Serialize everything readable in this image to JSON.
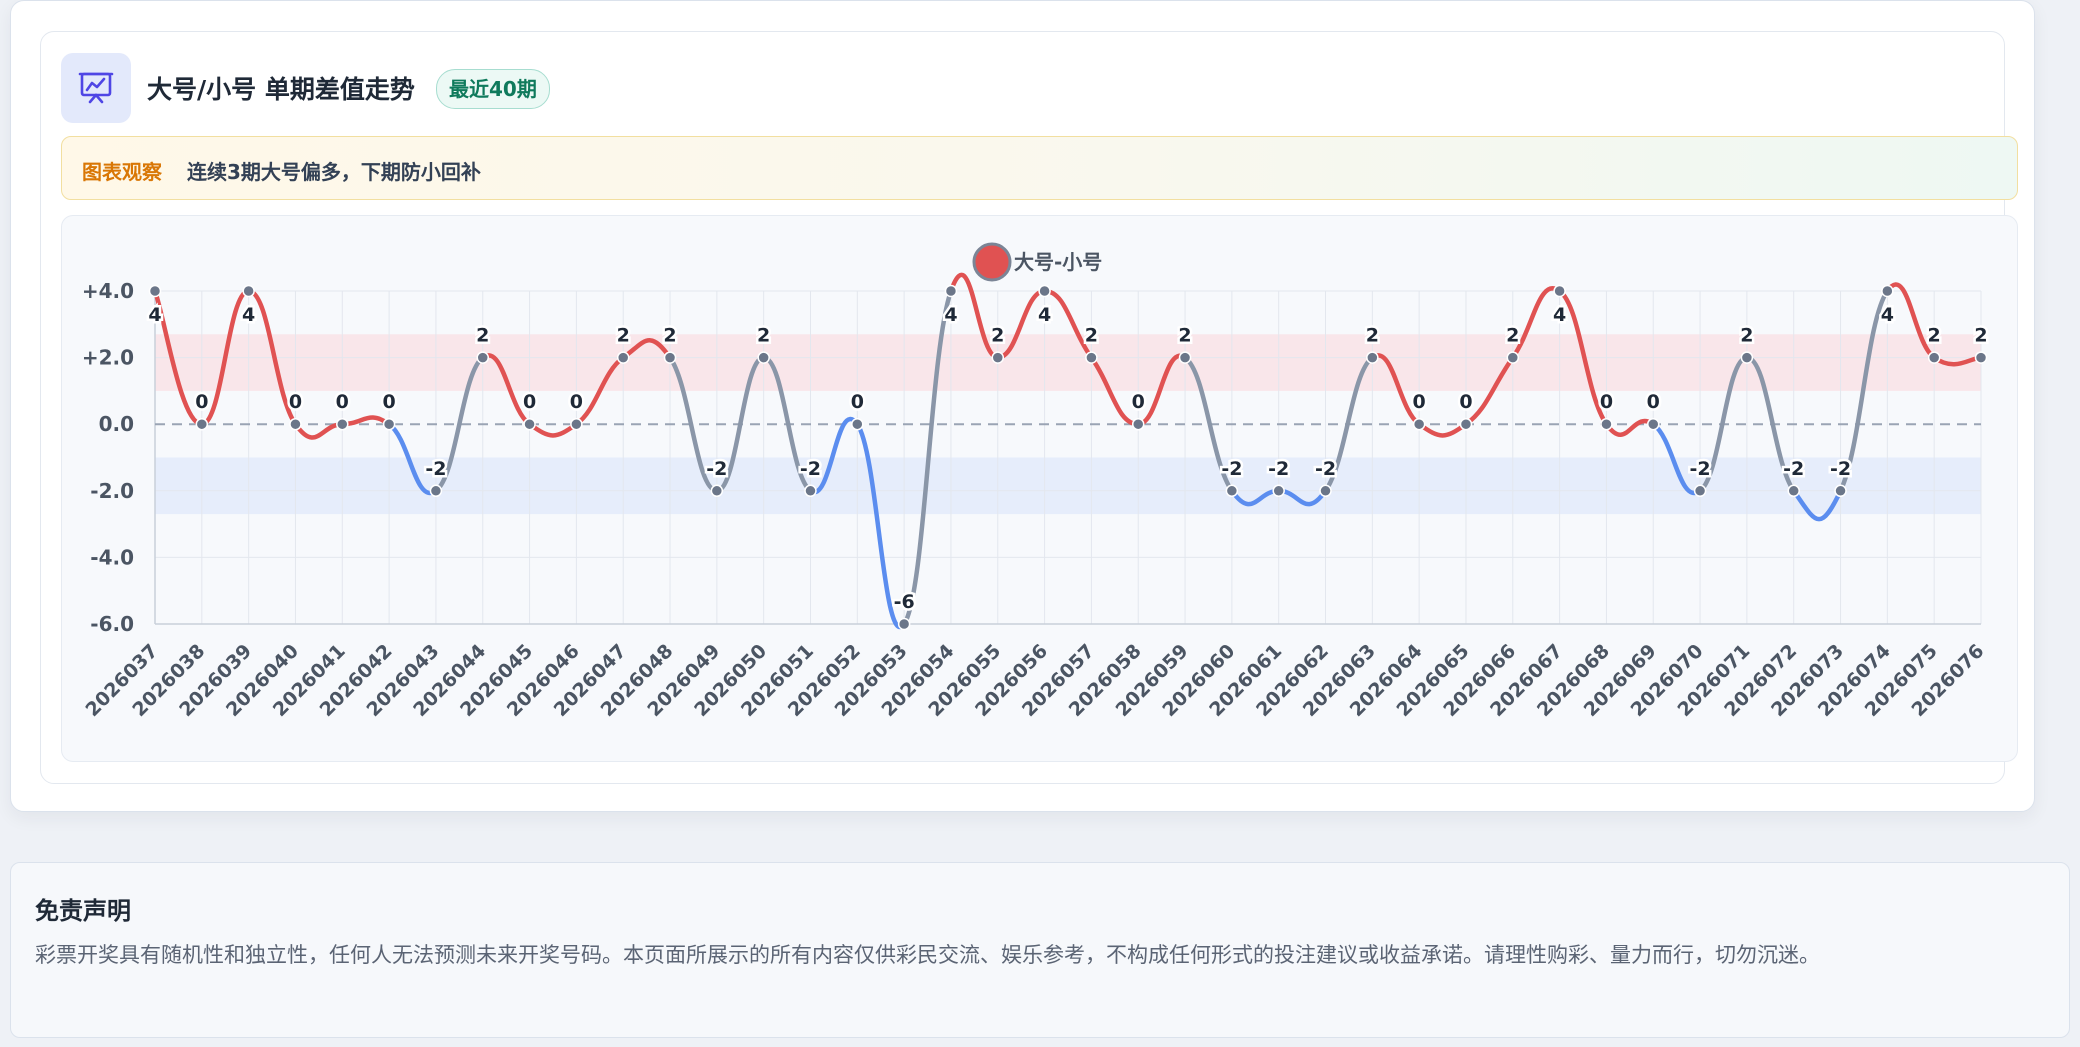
{
  "header": {
    "title": "大号/小号 单期差值走势",
    "badge": "最近40期",
    "icon": "presentation-chart-icon"
  },
  "insight": {
    "label": "图表观察",
    "text": "连续3期大号偏多，下期防小回补"
  },
  "disclaimer": {
    "title": "免责声明",
    "text": "彩票开奖具有随机性和独立性，任何人无法预测未来开奖号码。本页面所展示的所有内容仅供彩民交流、娱乐参考，不构成任何形式的投注建议或收益承诺。请理性购彩、量力而行，切勿沉迷。"
  },
  "colors": {
    "positive": "#e05252",
    "negative": "#5b8def",
    "neutral": "#8a96a8",
    "positive_band": "#f9e6ea",
    "negative_band": "#e6edfb",
    "insight_label": "#d97706",
    "badge_text": "#0f7a5c"
  },
  "chart_data": {
    "type": "line",
    "title": "",
    "xlabel": "",
    "ylabel": "",
    "legend": {
      "position": "top-center"
    },
    "ylim": [
      -6,
      4
    ],
    "yticks": [
      "+4.0",
      "+2.0",
      "0.0",
      "-2.0",
      "-4.0",
      "-6.0"
    ],
    "reference_line": 0,
    "bands": [
      {
        "from": 1,
        "to": 2.7,
        "color": "positive_band"
      },
      {
        "from": -2.7,
        "to": -1,
        "color": "negative_band"
      }
    ],
    "grid": true,
    "categories": [
      "2026037",
      "2026038",
      "2026039",
      "2026040",
      "2026041",
      "2026042",
      "2026043",
      "2026044",
      "2026045",
      "2026046",
      "2026047",
      "2026048",
      "2026049",
      "2026050",
      "2026051",
      "2026052",
      "2026053",
      "2026054",
      "2026055",
      "2026056",
      "2026057",
      "2026058",
      "2026059",
      "2026060",
      "2026061",
      "2026062",
      "2026063",
      "2026064",
      "2026065",
      "2026066",
      "2026067",
      "2026068",
      "2026069",
      "2026070",
      "2026071",
      "2026072",
      "2026073",
      "2026074",
      "2026075",
      "2026076"
    ],
    "series": [
      {
        "name": "大号-小号",
        "values": [
          4,
          0,
          4,
          0,
          0,
          0,
          -2,
          2,
          0,
          0,
          2,
          2,
          -2,
          2,
          -2,
          0,
          -6,
          4,
          2,
          4,
          2,
          0,
          2,
          -2,
          -2,
          -2,
          2,
          0,
          0,
          2,
          4,
          0,
          0,
          -2,
          2,
          -2,
          -2,
          4,
          2,
          2
        ]
      }
    ]
  }
}
